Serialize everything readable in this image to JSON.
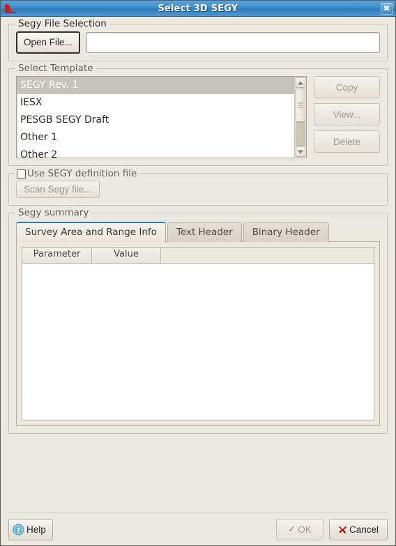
{
  "window": {
    "title": "Select 3D SEGY",
    "app_icon": "segy-wave-icon",
    "close_label": "✖"
  },
  "file_selection": {
    "group_title": "Segy File Selection",
    "open_button": "Open File...",
    "path_value": "",
    "path_placeholder": ""
  },
  "select_template": {
    "group_title": "Select Template",
    "items": [
      {
        "label": "SEGY Rev. 1",
        "selected": true
      },
      {
        "label": "IESX",
        "selected": false
      },
      {
        "label": "PESGB SEGY Draft",
        "selected": false
      },
      {
        "label": "Other 1",
        "selected": false
      },
      {
        "label": "Other 2",
        "selected": false
      }
    ],
    "buttons": [
      {
        "label": "Copy",
        "enabled": false
      },
      {
        "label": "View...",
        "enabled": false
      },
      {
        "label": "Delete",
        "enabled": false
      }
    ],
    "scrollbar": {
      "up_icon": "triangle-up-icon",
      "down_icon": "triangle-down-icon"
    }
  },
  "definition_file": {
    "group_title": "Use SEGY definition file",
    "checked": false,
    "scan_button": "Scan Segy file...",
    "scan_enabled": false
  },
  "segy_summary": {
    "group_title": "Segy summary",
    "tabs": [
      {
        "label": "Survey Area and Range Info",
        "active": true
      },
      {
        "label": "Text Header",
        "active": false
      },
      {
        "label": "Binary Header",
        "active": false
      }
    ],
    "table": {
      "columns": [
        "Parameter",
        "Value"
      ],
      "rows": []
    }
  },
  "footer": {
    "help_label": "Help",
    "help_icon": "question-circle-icon",
    "ok_label": "OK",
    "ok_icon": "check-icon",
    "ok_enabled": false,
    "cancel_label": "Cancel",
    "cancel_icon": "red-x-icon"
  },
  "colors": {
    "titlebar_blue": "#3f8ecb",
    "accent_tab": "#2f7cba",
    "dialog_bg": "#ece9e0",
    "selection_gray": "#c6c3bc",
    "cancel_red": "#c00000",
    "help_blue": "#4f9fd4"
  }
}
